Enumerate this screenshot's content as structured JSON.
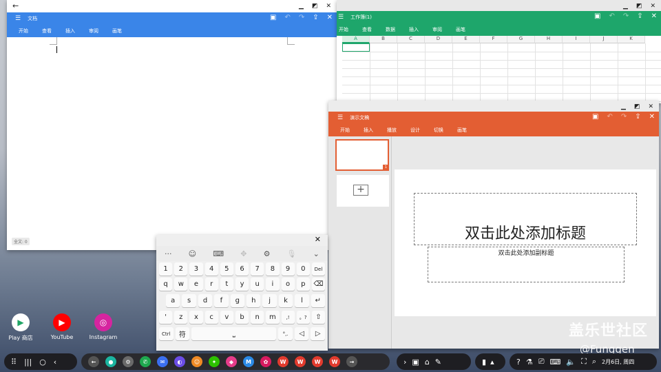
{
  "doc": {
    "back_icon": "←",
    "app_title": "文档",
    "tabs": [
      "开始",
      "查看",
      "插入",
      "审阅",
      "画笔"
    ],
    "word_count": "全文: 0"
  },
  "sheet": {
    "app_title": "工作簿(1)",
    "tabs": [
      "开始",
      "查看",
      "数据",
      "插入",
      "审阅",
      "画笔"
    ],
    "columns": [
      "A",
      "B",
      "C",
      "D",
      "E",
      "F",
      "G",
      "H",
      "I",
      "J",
      "K"
    ]
  },
  "ppt": {
    "app_title": "演示文稿",
    "tabs": [
      "开始",
      "插入",
      "播放",
      "设计",
      "切换",
      "画笔"
    ],
    "slide_number": "1",
    "title_placeholder": "双击此处添加标题",
    "subtitle_placeholder": "双击此处添加副标题"
  },
  "keyboard": {
    "close_label": "✕",
    "row1": [
      "1",
      "2",
      "3",
      "4",
      "5",
      "6",
      "7",
      "8",
      "9",
      "0",
      "Del"
    ],
    "row2": [
      "q",
      "w",
      "e",
      "r",
      "t",
      "y",
      "u",
      "i",
      "o",
      "p",
      "⌫"
    ],
    "row3": [
      "a",
      "s",
      "d",
      "f",
      "g",
      "h",
      "j",
      "k",
      "l",
      "↵"
    ],
    "row4": [
      "'",
      "z",
      "x",
      "c",
      "v",
      "b",
      "n",
      "m",
      ",!",
      "。?",
      "⇧"
    ],
    "row5": [
      "Ctrl",
      "符",
      "⎵",
      "°,.",
      "◁",
      "▷"
    ]
  },
  "desktop_apps": [
    {
      "label": "Play 商店",
      "color": "#ffffff",
      "glyph": "▶",
      "icon": "play-store-icon"
    },
    {
      "label": "YouTube",
      "color": "#ff0000",
      "glyph": "▶",
      "icon": "youtube-icon"
    },
    {
      "label": "Instagram",
      "color": "#d6249f",
      "glyph": "◎",
      "icon": "instagram-icon"
    }
  ],
  "watermark": {
    "line1": "盖乐世社区",
    "line2": "@Funggen"
  },
  "taskbar": {
    "clock": "2月6日, 周四"
  },
  "colors": {
    "doc_accent": "#3a85e8",
    "sheet_accent": "#1ea66b",
    "ppt_accent": "#e35e33"
  }
}
